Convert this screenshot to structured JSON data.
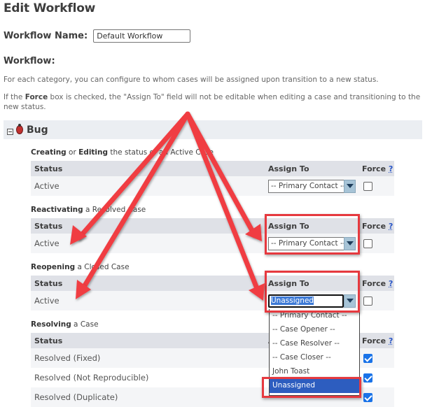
{
  "page": {
    "title": "Edit Workflow"
  },
  "workflow_name": {
    "label": "Workflow Name:",
    "value": "Default Workflow"
  },
  "workflow_section": {
    "label": "Workflow:",
    "help_1": "For each category, you can configure to whom cases will be assigned upon transition to a new status.",
    "help_2_prefix": "If the ",
    "help_2_bold": "Force",
    "help_2_suffix": " box is checked, the \"Assign To\" field will not be editable when editing a case and transitioning to the new status."
  },
  "category": {
    "name": "Bug",
    "icon": "bug-icon",
    "expanded": true
  },
  "columns": {
    "status": "Status",
    "assign_to": "Assign To",
    "force": "Force",
    "force_help": "?"
  },
  "sections": [
    {
      "title_bold": "Creating",
      "title_mid": " or ",
      "title_bold2": "Editing",
      "title_rest": " the status of an Active Case",
      "rows": [
        {
          "status": "Active",
          "assign_to": "-- Primary Contact --",
          "force": false
        }
      ]
    },
    {
      "title_bold": "Reactivating",
      "title_rest": " a Resolved Case",
      "rows": [
        {
          "status": "Active",
          "assign_to": "-- Primary Contact --",
          "force": false
        }
      ]
    },
    {
      "title_bold": "Reopening",
      "title_rest": " a Closed Case",
      "rows": [
        {
          "status": "Active",
          "assign_to": "Unassigned",
          "force": false
        }
      ]
    },
    {
      "title_bold": "Resolving",
      "title_rest": " a Case",
      "rows": [
        {
          "status": "Resolved (Fixed)",
          "force": true
        },
        {
          "status": "Resolved (Not Reproducible)",
          "force": true
        },
        {
          "status": "Resolved (Duplicate)",
          "force": true
        }
      ]
    }
  ],
  "dropdown": {
    "options": [
      "-- Primary Contact --",
      "-- Case Opener --",
      "-- Case Resolver --",
      "-- Case Closer --",
      "John Toast",
      "Unassigned"
    ],
    "selected": "Unassigned"
  },
  "annotations": {
    "arrow_color": "#e6393f",
    "box_color": "#e6393f"
  }
}
